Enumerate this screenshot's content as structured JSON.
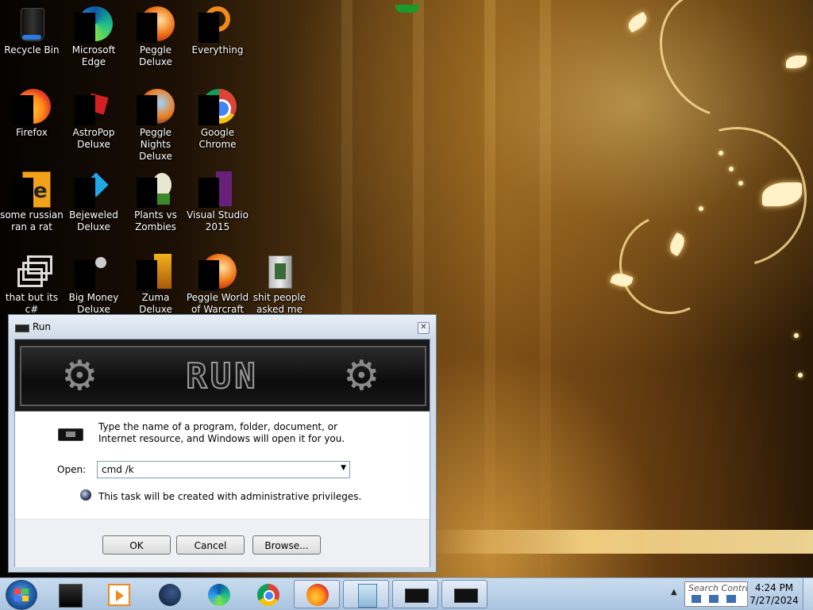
{
  "desktop": {
    "icons": [
      {
        "label": "Recycle Bin",
        "icon": "recycle-bin-icon"
      },
      {
        "label": "Microsoft Edge",
        "icon": "edge-icon"
      },
      {
        "label": "Peggle Deluxe",
        "icon": "peggle-icon"
      },
      {
        "label": "Everything",
        "icon": "everything-search-icon"
      },
      {
        "label": "Firefox",
        "icon": "firefox-icon"
      },
      {
        "label": "AstroPop Deluxe",
        "icon": "astropop-icon"
      },
      {
        "label": "Peggle Nights Deluxe",
        "icon": "peggle-nights-icon"
      },
      {
        "label": "Google Chrome",
        "icon": "chrome-icon"
      },
      {
        "label": "some russian ran a rat",
        "icon": "shortcut-icon"
      },
      {
        "label": "Bejeweled Deluxe",
        "icon": "bejeweled-icon"
      },
      {
        "label": "Plants vs Zombies",
        "icon": "plants-vs-zombies-icon"
      },
      {
        "label": "Visual Studio 2015",
        "icon": "visual-studio-icon"
      },
      {
        "label": "that but its c#",
        "icon": "shortcut-icon"
      },
      {
        "label": "Big Money Deluxe",
        "icon": "big-money-icon"
      },
      {
        "label": "Zuma Deluxe",
        "icon": "zuma-icon"
      },
      {
        "label": "Peggle World of Warcraft",
        "icon": "peggle-wow-icon"
      },
      {
        "label": "shit people asked me",
        "icon": "folder-icon"
      }
    ]
  },
  "run_dialog": {
    "title": "Run",
    "banner_text": "RUN",
    "description": "Type the name of a program, folder, document, or Internet resource, and Windows will open it for you.",
    "open_label": "Open:",
    "open_value": "cmd /k",
    "admin_note": "This task will be created with administrative privileges.",
    "ok_label": "OK",
    "cancel_label": "Cancel",
    "browse_label": "Browse..."
  },
  "taskbar": {
    "apps": [
      {
        "name": "cmd-app-icon",
        "active": false
      },
      {
        "name": "media-player-icon",
        "active": false
      },
      {
        "name": "steam-icon",
        "active": false
      },
      {
        "name": "edge-icon",
        "active": false
      },
      {
        "name": "chrome-icon",
        "active": false
      },
      {
        "name": "firefox-icon",
        "active": true
      },
      {
        "name": "notepad-icon",
        "active": true
      },
      {
        "name": "run-window-icon",
        "active": true
      },
      {
        "name": "run-window-icon",
        "active": true
      }
    ],
    "search_text": "Search Contro",
    "time": "4:24 PM",
    "date": "7/27/2024"
  },
  "colors": {
    "taskbar": "#b9cfe7",
    "dialog_frame": "#cfdbe8"
  }
}
